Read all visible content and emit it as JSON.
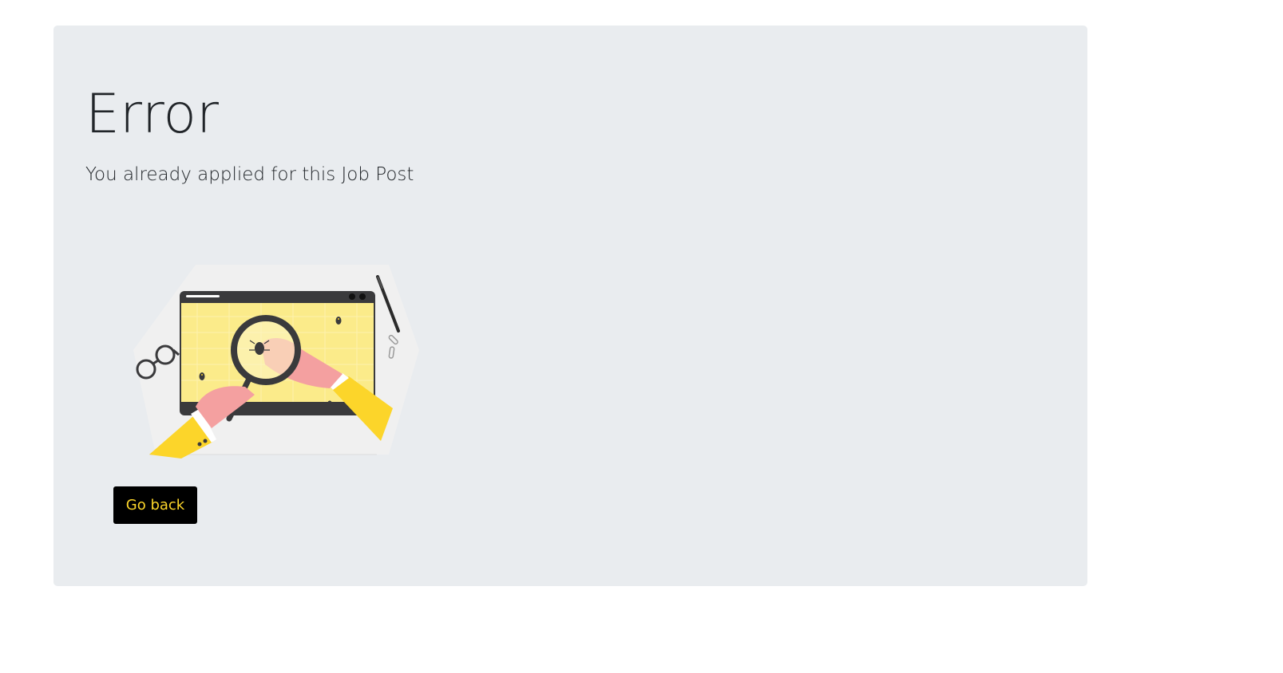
{
  "error": {
    "title": "Error",
    "message": "You already applied for this Job Post"
  },
  "illustration": {
    "icon": "bug-search-illustration",
    "colors": {
      "accent_yellow": "#fcd52a",
      "screen_yellow": "#fbeb8a",
      "skin_pink": "#f4a0a0",
      "dark": "#3a3a3c",
      "backdrop": "#f0f0f0"
    }
  },
  "actions": {
    "go_back_label": "Go back"
  },
  "colors": {
    "page_background": "#ffffff",
    "panel_background": "#e9ecef",
    "text": "#212529",
    "button_background": "#000000",
    "button_text": "#fcd52a"
  }
}
